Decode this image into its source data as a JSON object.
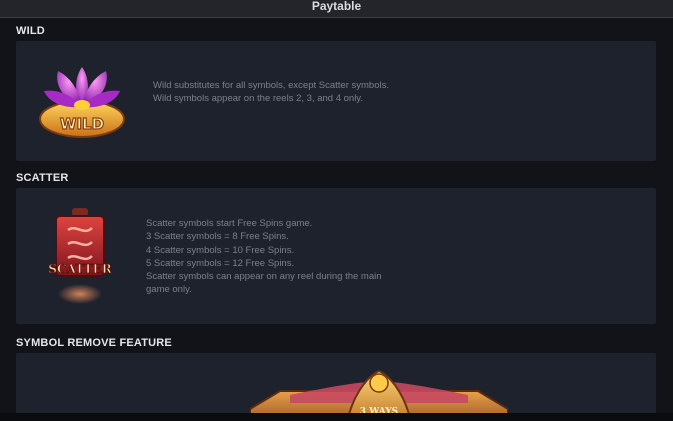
{
  "header": {
    "title": "Paytable"
  },
  "sections": {
    "wild": {
      "title": "WILD",
      "icon_name": "lotus-wild-icon",
      "icon_text": "WILD",
      "lines": [
        "Wild substitutes for all symbols, except Scatter symbols.",
        "Wild symbols appear on the reels 2, 3, and 4 only."
      ]
    },
    "scatter": {
      "title": "SCATTER",
      "icon_name": "lantern-scatter-icon",
      "icon_text": "SCATTER",
      "lines": [
        "Scatter symbols start Free Spins game.",
        "3 Scatter symbols = 8 Free Spins.",
        "4 Scatter symbols = 10 Free Spins.",
        "5 Scatter symbols = 12 Free Spins.",
        "Scatter symbols can appear on any reel during the main",
        "game only."
      ]
    },
    "symbol_remove": {
      "title": "SYMBOL REMOVE FEATURE",
      "banner_text": "3 WAYS"
    }
  },
  "colors": {
    "background": "#111318",
    "panel": "#1e222c",
    "text_title": "#e4e6ea",
    "text_desc": "#7b808c",
    "lotus_petal": "#c23ad6",
    "wild_gold": "#e8a020",
    "scatter_red": "#c8303a"
  }
}
